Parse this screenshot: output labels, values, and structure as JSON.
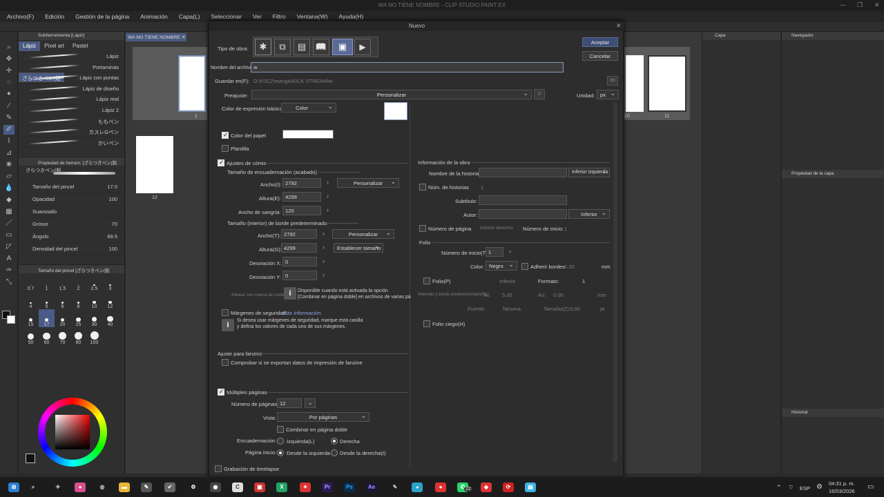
{
  "window": {
    "title": "WA NO TIENE NOMBRE - CLIP STUDIO PAINT EX"
  },
  "menu": [
    "Archivo(F)",
    "Edición",
    "Gestión de la página",
    "Animación",
    "Capa(L)",
    "Seleccionar",
    "Ver",
    "Filtro",
    "Ventana(W)",
    "Ayuda(H)"
  ],
  "subtool": {
    "header": "Subherramienta [Lápiz]",
    "tabs": [
      "Lápiz",
      "Pixel art",
      "Pastel"
    ],
    "brushes": [
      "Lápiz",
      "Portaminas",
      "ざらつきペン(鉛",
      "Lápiz con puntas",
      "Lápiz de diseño",
      "Lápiz real",
      "Lápiz 2",
      "ももペン",
      "カスレGペン",
      "かいペン"
    ]
  },
  "toolprop": {
    "header": "Propiedad de herram. [ざらつきペン(鉛",
    "brushname": "ざらつきペン(鉛",
    "rows": [
      {
        "label": "Tamaño del pincel",
        "value": "17.0"
      },
      {
        "label": "Opacidad",
        "value": "100"
      },
      {
        "label": "Suavizado",
        "value": ""
      },
      {
        "label": "Grosor",
        "value": "70"
      },
      {
        "label": "Ángulo",
        "value": "69.5"
      },
      {
        "label": "Densidad del pincel",
        "value": "100"
      }
    ]
  },
  "brushsize": {
    "header": "Tamaño del pincel [ざらつきペン(鉛",
    "sizes": [
      "0.7",
      "1",
      "1.5",
      "2",
      "2.5",
      "3",
      "4",
      "5",
      "6",
      "8",
      "10",
      "12",
      "15",
      "17",
      "20",
      "25",
      "30",
      "40",
      "50",
      "60",
      "70",
      "80",
      "100"
    ]
  },
  "canvas": {
    "tab": "WA NO TIENE NOMBRE",
    "left_page_number": "12",
    "right_page_numbers": [
      "10",
      "11"
    ],
    "top_page_number": "1"
  },
  "dialog": {
    "title": "Nuevo",
    "accept": "Aceptar",
    "cancel": "Cancelar",
    "tipo_label": "Tipo de obra:",
    "nombre_label": "Nombre del archivo:",
    "nombre_value": "w",
    "guardar_label": "Guardar en(F):",
    "guardar_value": "D:\\PJC2\\manga\\KICK STREAM\\w",
    "preajuste_label": "Preajuste:",
    "preajuste_value": "Personalizar",
    "unidad_label": "Unidad:",
    "unidad_value": "px",
    "color_basico_label": "Color de expresión básico:",
    "color_basico_value": "Color",
    "color_papel": "Color del papel",
    "plantilla": "Plantilla",
    "ajustes_comic": "Ajustes de cómic",
    "encuad_title": "Tamaño de encuadernación (acabado)",
    "ancho_i_label": "Ancho(I):",
    "ancho_i": "2792",
    "altura_e_label": "Altura(E):",
    "altura_e": "4299",
    "sangria_label": "Ancho de sangría:",
    "sangria": "120",
    "personalizar": "Personalizar",
    "borde_title": "Tamaño (interior) de borde predeterminado",
    "ancho_t_label": "Ancho(T):",
    "ancho_t": "2792",
    "altura_g_label": "Altura(G):",
    "altura_g": "4299",
    "establecer": "Establecer tamaño",
    "desv_x_label": "Desviación X:",
    "desv_x": "0",
    "desv_y_label": "Desviación Y:",
    "desv_y": "0",
    "alinear": "Alinear con marca de corte",
    "disponible_1": "Disponible cuando está activada la opción",
    "disponible_2": "[Combinar en página doble] en archivos de varias pá",
    "margenes": "Márgenes de seguridad",
    "mas_info": "Más información",
    "margenes_info_1": "Si desea usar márgenes de seguridad, marque esta casilla",
    "margenes_info_2": "y defina los valores de cada uno de sus márgenes.",
    "fanzine_title": "Ajuste para fanzine",
    "fanzine_cb": "Comprobar si se exportan datos de impresión de fanzine",
    "multiples": "Múltiples páginas",
    "num_paginas_label": "Número de páginas:",
    "num_paginas": "12",
    "vista_label": "Vista:",
    "vista": "Por páginas",
    "combinar": "Combinar en página doble",
    "encuadernacion_label": "Encuadernación:",
    "izquierda": "Izquierda(L)",
    "derecha": "Derecha",
    "pagina_inicio_label": "Página inicio:",
    "desde_izq": "Desde la izquierda",
    "desde_der": "Desde la derecha(I)",
    "timelapse": "Grabación de timelapse",
    "info_title": "Información de la obra",
    "nombre_historia": "Nombre de la historia:",
    "inferior_izquierda": "Inferior izquierda",
    "num_historias": "Núm. de historias",
    "num_historias_val": "1",
    "subtitulo": "Subtítulo:",
    "autor": "Autor:",
    "inferior": "Inferior",
    "num_pagina": "Número de página",
    "inferior_derecha": "Inferior derecha",
    "num_inicio_label": "Número de inicio:",
    "num_inicio_val": "1",
    "folio_title": "Folio",
    "num_inicio_t": "Número de inicio(T):",
    "num_inicio_t_val": "1",
    "color_label": "Color:",
    "color_val": "Negro",
    "adherir": "Adherir bordes",
    "adherir_val": "0.30",
    "mm": "mm",
    "folio_p": "Folio(P)",
    "formato_label": "Formato:",
    "formato_val": "1",
    "intervalo": "Intervalo y borde predeterminado(B):",
    "al": "Al:",
    "al_val": "5.00",
    "an": "An:",
    "an_val": "0.00",
    "fuente": "Fuente:",
    "fuente_val": "Tahoma",
    "tamano_z": "Tamaño(Z):",
    "tamano_z_val": "9.00",
    "pt": "pt",
    "folio_ciego": "Folio ciego(H)"
  },
  "right": {
    "capa": "Capa",
    "navegador": "Navegador",
    "prop_capa": "Propiedad de la capa",
    "historial": "Historial"
  },
  "taskbar": {
    "lang": "ESP",
    "time": "04:31 p. m.",
    "date": "16/03/2026",
    "badge": "22"
  }
}
